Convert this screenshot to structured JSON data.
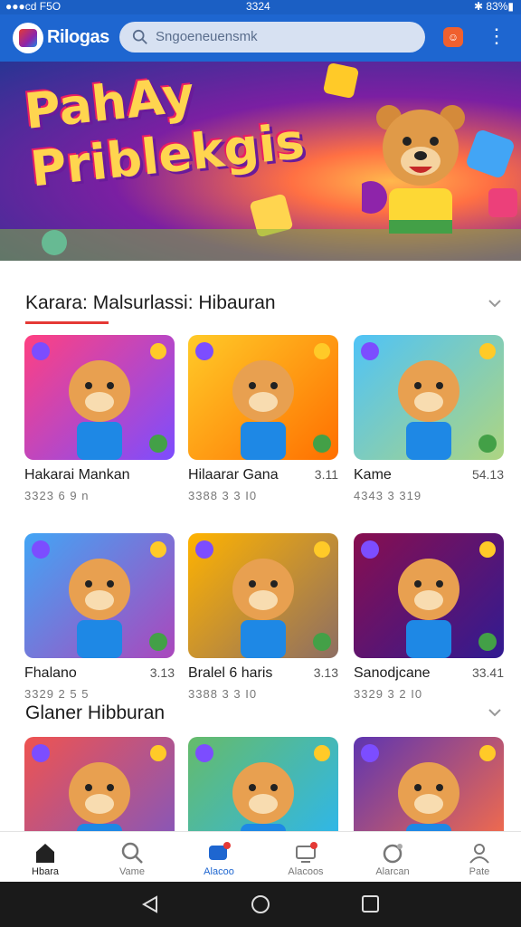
{
  "status": {
    "left": "●●●cd F5O",
    "time": "3324",
    "right": "✱ 83%▮"
  },
  "app": {
    "name": "Rilogas"
  },
  "search": {
    "placeholder": "Sngoeneuensmk"
  },
  "banner": {
    "title_line1": "PahAy",
    "title_line2": "Priblekgis"
  },
  "section1": {
    "title": "Karara: Malsurlassi: Hibauran",
    "cards": [
      {
        "name": "Hakarai Mankan",
        "rating": "",
        "meta": "3323 6 9 n",
        "colors": [
          "#ff4081",
          "#7c4dff"
        ]
      },
      {
        "name": "Hilaarar Gana",
        "rating": "3.11",
        "meta": "3388 3 3 I0",
        "colors": [
          "#ffca28",
          "#ff6f00"
        ]
      },
      {
        "name": "Kame",
        "rating": "54.13",
        "meta": "4343 3 319",
        "colors": [
          "#4fc3f7",
          "#aed581"
        ]
      },
      {
        "name": "Fhalano",
        "rating": "3.13",
        "meta": "3329 2 5 5",
        "colors": [
          "#42a5f5",
          "#ab47bc"
        ]
      },
      {
        "name": "Bralel 6 haris",
        "rating": "3.13",
        "meta": "3388 3 3 I0",
        "colors": [
          "#ffb300",
          "#8d6e63"
        ]
      },
      {
        "name": "Sanodjcane",
        "rating": "33.41",
        "meta": "3329 3 2 I0",
        "colors": [
          "#880e4f",
          "#311b92"
        ]
      }
    ]
  },
  "section2": {
    "title": "Glaner Hibburan",
    "cards": [
      {
        "colors": [
          "#ef5350",
          "#7e57c2"
        ]
      },
      {
        "colors": [
          "#66bb6a",
          "#29b6f6"
        ]
      },
      {
        "colors": [
          "#5e35b1",
          "#ff7043"
        ]
      }
    ]
  },
  "nav": [
    {
      "label": "Hbara",
      "icon": "home-icon"
    },
    {
      "label": "Vame",
      "icon": "search-icon"
    },
    {
      "label": "Alacoo",
      "icon": "chat-icon"
    },
    {
      "label": "Alacoos",
      "icon": "monitor-icon"
    },
    {
      "label": "Alarcan",
      "icon": "timer-icon"
    },
    {
      "label": "Pate",
      "icon": "profile-icon"
    }
  ]
}
